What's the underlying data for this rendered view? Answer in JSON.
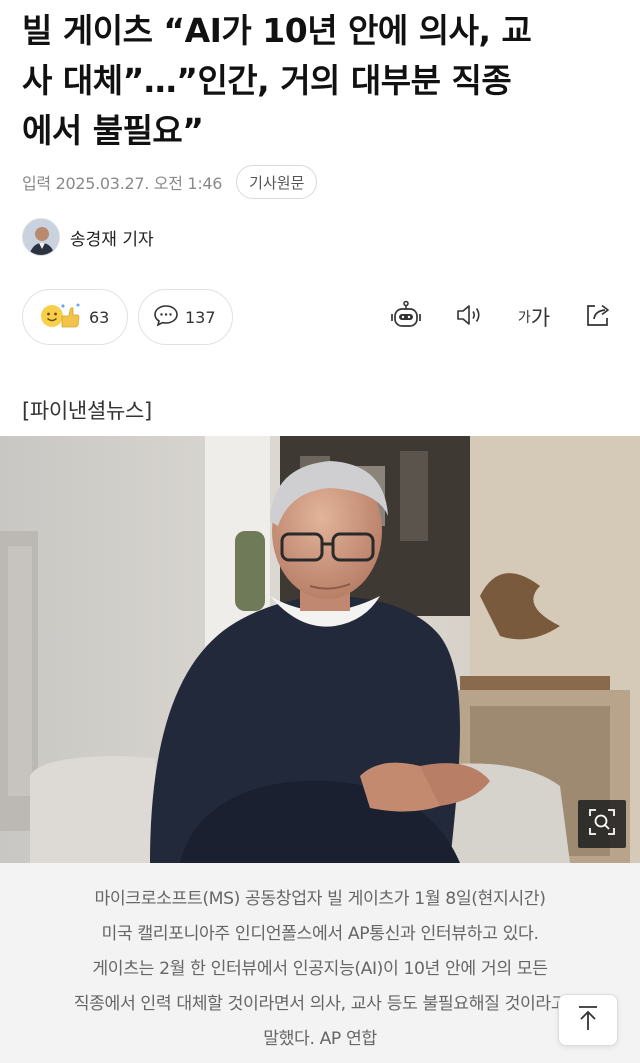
{
  "article": {
    "headline_lines": [
      "빌 게이츠 “AI가 10년 안에 의사, 교",
      "사 대체”…”인간, 거의 대부분 직종",
      "에서 불필요”"
    ],
    "date": "입력 2025.03.27. 오전 1:46",
    "original_label": "기사원문",
    "reporter": "송경재 기자",
    "source": "[파이낸셜뉴스]"
  },
  "actions": {
    "like_count": "63",
    "comment_count": "137",
    "font_label_small": "가",
    "font_label_big": "가"
  },
  "photo": {
    "caption_lines": [
      "마이크로소프트(MS) 공동창업자 빌 게이츠가 1월 8일(현지시간)",
      "미국 캘리포니아주 인디언폴스에서 AP통신과 인터뷰하고 있다.",
      "게이츠는 2월 한 인터뷰에서 인공지능(AI)이 10년 안에 거의 모든",
      "직종에서 인력 대체할 것이라면서 의사, 교사 등도 불필요해질 것이라고",
      "말했다. AP 연합"
    ]
  },
  "icons": {
    "like": "reaction-emoji-icon",
    "comment": "speech-bubble-icon",
    "bot": "robot-summary-icon",
    "sound": "speaker-icon",
    "share": "share-icon",
    "zoom": "zoom-search-icon",
    "top": "arrow-up-icon"
  }
}
